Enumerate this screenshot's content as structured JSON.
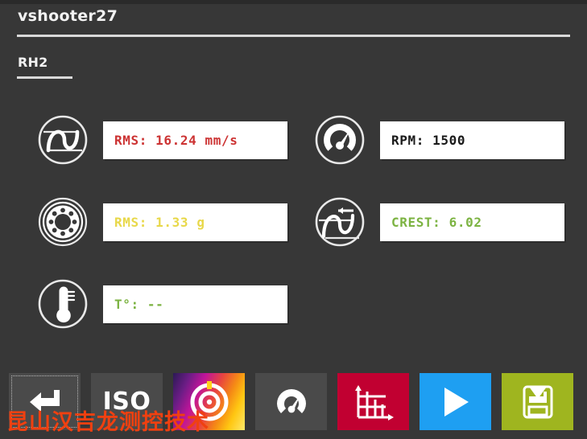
{
  "window": {
    "app_title": "vshooter27",
    "section_title": "RH2"
  },
  "colors": {
    "background": "#373737",
    "rule": "#d9d9d9",
    "value_box_bg": "#ffffff",
    "velocity_text": "#cc3333",
    "rpm_text": "#1a1a1a",
    "acceleration_text": "#e8d84a",
    "crest_text": "#7cb342",
    "temperature_text": "#7cb342",
    "toolbar_grey": "#4a4a4a",
    "toolbar_red": "#c10031",
    "toolbar_blue": "#1e9ff2",
    "toolbar_olive": "#9fb51f",
    "watermark": "#f04010"
  },
  "metrics": [
    {
      "id": "velocity-rms",
      "icon": "sine-wave-icon",
      "value": "RMS: 16.24 mm/s",
      "color": "#cc3333"
    },
    {
      "id": "rpm",
      "icon": "tachometer-icon",
      "value": "RPM: 1500",
      "color": "#1a1a1a"
    },
    {
      "id": "acceleration-rms",
      "icon": "bearing-icon",
      "value": "RMS: 1.33 g",
      "color": "#e8d84a"
    },
    {
      "id": "crest-factor",
      "icon": "crest-wave-icon",
      "value": "CREST: 6.02",
      "color": "#7cb342"
    },
    {
      "id": "temperature",
      "icon": "thermometer-icon",
      "value": "T°: --",
      "color": "#7cb342"
    }
  ],
  "toolbar": {
    "buttons": [
      {
        "id": "back",
        "icon": "back-arrow-icon",
        "label": "",
        "style": "grey",
        "focused": true
      },
      {
        "id": "iso",
        "icon": "iso-text-icon",
        "label": "ISO",
        "style": "grey",
        "focused": false
      },
      {
        "id": "colormap",
        "icon": "target-circles-icon",
        "label": "",
        "style": "gradient",
        "focused": false
      },
      {
        "id": "tachometer",
        "icon": "gauge-icon",
        "label": "",
        "style": "grey",
        "focused": false
      },
      {
        "id": "spectrum",
        "icon": "bar-chart-icon",
        "label": "",
        "style": "red",
        "focused": false
      },
      {
        "id": "play",
        "icon": "play-triangle-icon",
        "label": "",
        "style": "blue",
        "focused": false
      },
      {
        "id": "save",
        "icon": "save-disk-icon",
        "label": "",
        "style": "olive",
        "focused": false
      }
    ]
  },
  "watermark": {
    "text": "昆山汉吉龙测控技术"
  }
}
